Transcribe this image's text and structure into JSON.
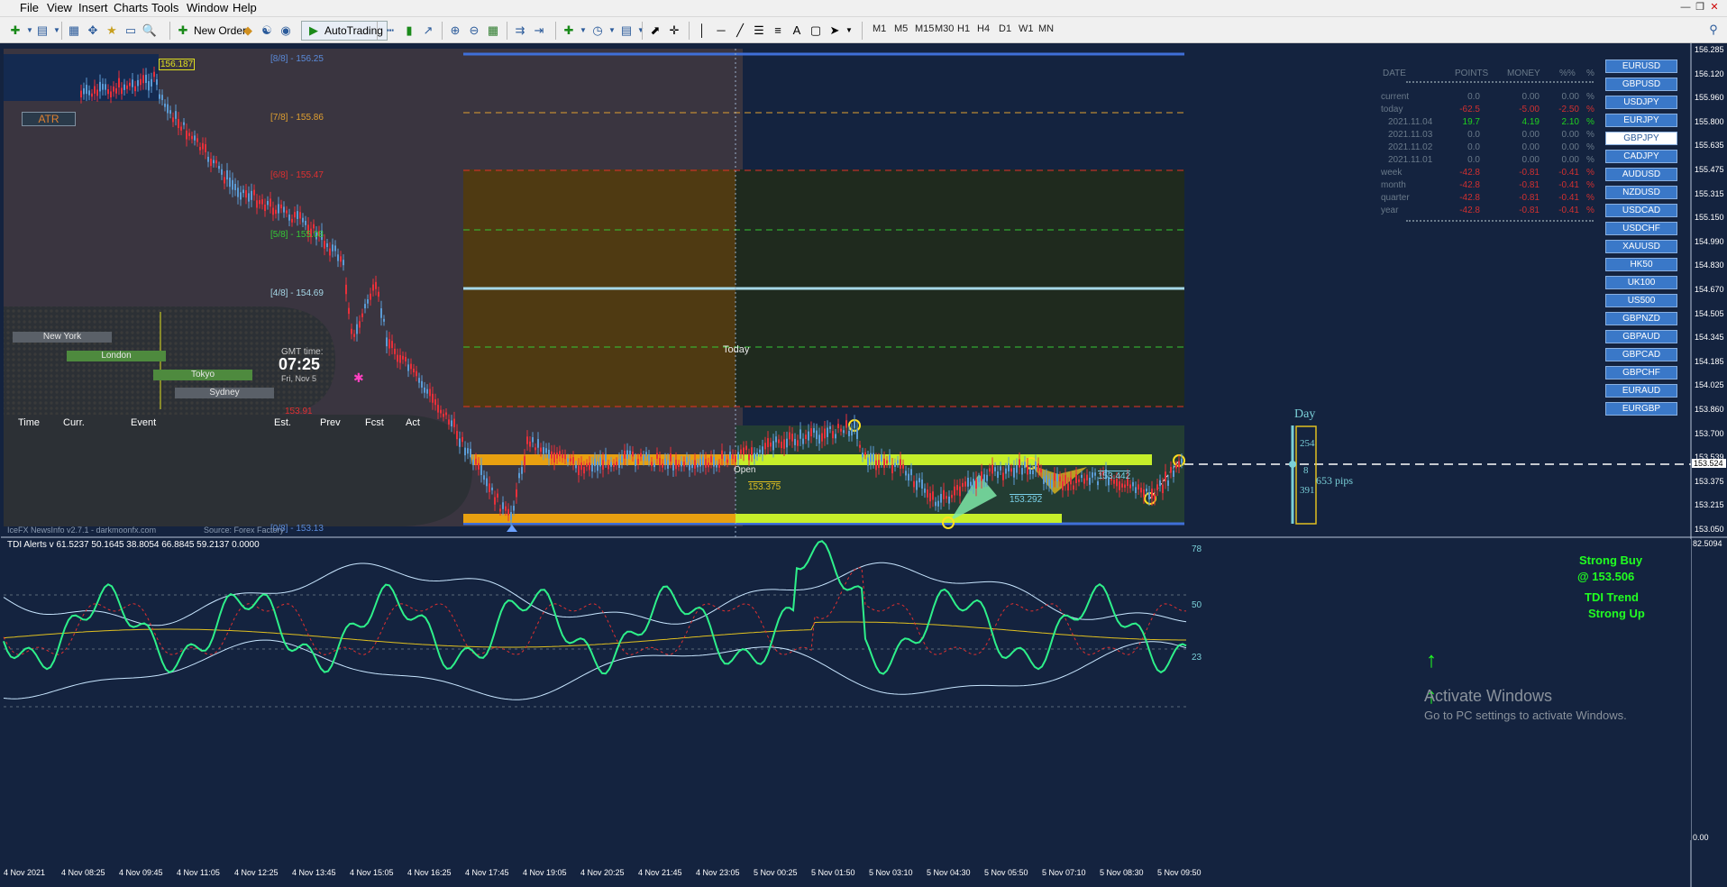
{
  "menu": [
    "File",
    "View",
    "Insert",
    "Charts",
    "Tools",
    "Window",
    "Help"
  ],
  "toolbar": {
    "new_order": "New Order",
    "autotrading": "AutoTrading",
    "timeframes": [
      "M1",
      "M5",
      "M15",
      "M30",
      "H1",
      "H4",
      "D1",
      "W1",
      "MN"
    ]
  },
  "price_axis": [
    "156.285",
    "156.120",
    "155.960",
    "155.800",
    "155.635",
    "155.475",
    "155.315",
    "155.150",
    "154.990",
    "154.830",
    "154.670",
    "154.505",
    "154.345",
    "154.185",
    "154.025",
    "153.860",
    "153.700",
    "153.539",
    "153.375",
    "153.215",
    "153.050"
  ],
  "current_price": "153.524",
  "time_axis": [
    "4 Nov 2021",
    "4 Nov 08:25",
    "4 Nov 09:45",
    "4 Nov 11:05",
    "4 Nov 12:25",
    "4 Nov 13:45",
    "4 Nov 15:05",
    "4 Nov 16:25",
    "4 Nov 17:45",
    "4 Nov 19:05",
    "4 Nov 20:25",
    "4 Nov 21:45",
    "4 Nov 23:05",
    "5 Nov 00:25",
    "5 Nov 01:50",
    "5 Nov 03:10",
    "5 Nov 04:30",
    "5 Nov 05:50",
    "5 Nov 07:10",
    "5 Nov 08:30",
    "5 Nov 09:50"
  ],
  "murrey": {
    "l88": "[8/8] - 156.25",
    "l78": "[7/8] - 155.86",
    "l68": "[6/8] - 155.47",
    "l58": "[5/8] - 155.08",
    "l48": "[4/8] - 154.69",
    "l38": "153.91",
    "l08": "[0/8] - 153.13"
  },
  "labels": {
    "price_box": "156.187",
    "atr": "ATR",
    "today": "Today",
    "open": "Open",
    "p1": "153.375",
    "p2": "153.292",
    "p3": "153.442",
    "day": "Day",
    "d_top": "254",
    "d_mid": "8",
    "d_bot": "391",
    "pips": "653 pips",
    "footer_left": "IceFX NewsInfo v2.7.1 - darkmoonfx.com",
    "footer_right": "Source: Forex Factory"
  },
  "world": {
    "cities": [
      "New York",
      "London",
      "Tokyo",
      "Sydney"
    ],
    "gmt_label": "GMT time:",
    "time": "07:25",
    "date": "Fri, Nov 5"
  },
  "news_headers": [
    "Time",
    "Curr.",
    "Event",
    "Est.",
    "Prev",
    "Fcst",
    "Act"
  ],
  "stats": {
    "headers": [
      "DATE",
      "POINTS",
      "MONEY",
      "%%",
      "%"
    ],
    "rows": [
      {
        "d": "current",
        "p": "0.0",
        "m": "0.00",
        "pc": "0.00",
        "s": "%"
      },
      {
        "d": "today",
        "p": "-62.5",
        "m": "-5.00",
        "pc": "-2.50",
        "s": "%"
      },
      {
        "d": "2021.11.04",
        "p": "19.7",
        "m": "4.19",
        "pc": "2.10",
        "s": "%"
      },
      {
        "d": "2021.11.03",
        "p": "0.0",
        "m": "0.00",
        "pc": "0.00",
        "s": "%"
      },
      {
        "d": "2021.11.02",
        "p": "0.0",
        "m": "0.00",
        "pc": "0.00",
        "s": "%"
      },
      {
        "d": "2021.11.01",
        "p": "0.0",
        "m": "0.00",
        "pc": "0.00",
        "s": "%"
      },
      {
        "d": "week",
        "p": "-42.8",
        "m": "-0.81",
        "pc": "-0.41",
        "s": "%"
      },
      {
        "d": "month",
        "p": "-42.8",
        "m": "-0.81",
        "pc": "-0.41",
        "s": "%"
      },
      {
        "d": "quarter",
        "p": "-42.8",
        "m": "-0.81",
        "pc": "-0.41",
        "s": "%"
      },
      {
        "d": "year",
        "p": "-42.8",
        "m": "-0.81",
        "pc": "-0.41",
        "s": "%"
      }
    ]
  },
  "symbols": [
    "EURUSD",
    "GBPUSD",
    "USDJPY",
    "EURJPY",
    "GBPJPY",
    "CADJPY",
    "AUDUSD",
    "NZDUSD",
    "USDCAD",
    "USDCHF",
    "XAUUSD",
    "HK50",
    "UK100",
    "US500",
    "GBPNZD",
    "GBPAUD",
    "GBPCAD",
    "GBPCHF",
    "EURAUD",
    "EURGBP"
  ],
  "selected_symbol": "GBPJPY",
  "tdi": {
    "title": "TDI Alerts v 61.5237 50.1645 38.8054 66.8845 59.2137 0.0000",
    "scale_top": "82.5094",
    "scale_bottom": "0.00",
    "level_top": "78",
    "level_mid": "50",
    "level_bot": "23",
    "signal1": "Strong Buy",
    "signal2": "@ 153.506",
    "trend1": "TDI Trend",
    "trend2": "Strong Up"
  },
  "watermark": {
    "line1": "Activate Windows",
    "line2": "Go to PC settings to activate Windows."
  },
  "colors": {
    "background": "#14233f",
    "bull_candle": "#5b9bd5",
    "bear_candle": "#e8303a",
    "tdi_green": "#2ef08a",
    "band": "#c8e6ff",
    "signal": "#21ff21"
  }
}
